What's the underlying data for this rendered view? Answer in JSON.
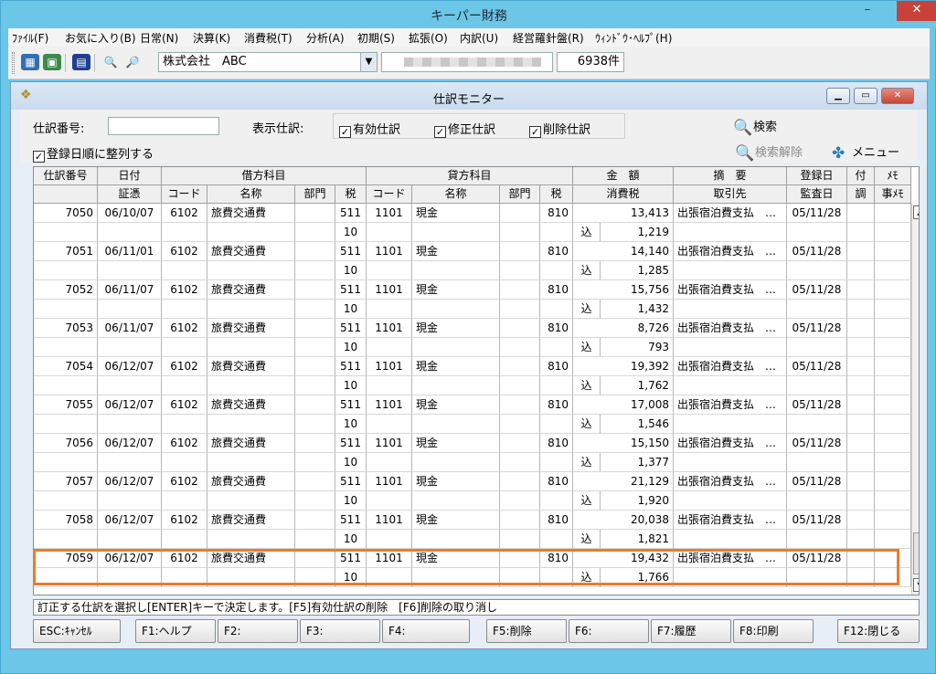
{
  "app": {
    "title": "キーパー財務",
    "window_buttons": {
      "minimize": "–",
      "maximize": "□",
      "close": "✕"
    }
  },
  "menu": [
    "ﾌｧｲﾙ(F)",
    "お気に入り(B)",
    "日常(N)",
    "決算(K)",
    "消費税(T)",
    "分析(A)",
    "初期(S)",
    "拡張(O)",
    "内訳(U)",
    "経営羅針盤(R)",
    "ｳｨﾝﾄﾞｳ･ﾍﾙﾌﾟ(H)"
  ],
  "toolbar": {
    "company": "株式会社　ABC",
    "count": "6938件"
  },
  "monitor": {
    "title": "仕訳モニター",
    "journal_no_label": "仕訳番号:",
    "journal_no_value": "",
    "display_label": "表示仕訳:",
    "checks": {
      "valid": "有効仕訳",
      "corrected": "修正仕訳",
      "deleted": "削除仕訳",
      "sort": "登録日順に整列する"
    },
    "search_label": "検索",
    "search_clear_label": "検索解除",
    "menu_label": "メニュー"
  },
  "grid": {
    "headers": {
      "journal_no": "仕訳番号",
      "date": "日付",
      "voucher": "証憑",
      "debit": "借方科目",
      "credit": "貸方科目",
      "code": "コード",
      "name": "名称",
      "dept": "部門",
      "tax": "税",
      "amount": "金　額",
      "consumption_tax": "消費税",
      "summary": "摘　要",
      "partner": "取引先",
      "reg_date": "登録日",
      "audit_date": "監査日",
      "attach": "付",
      "adjust": "調",
      "memo": "ﾒﾓ",
      "memo2": "事ﾒﾓ"
    },
    "rows": [
      {
        "no": "7050",
        "date": "06/10/07",
        "dcode": "6102",
        "dname": "旅費交通費",
        "dtax": "511",
        "dtax2": "10",
        "ccode": "1101",
        "cname": "現金",
        "ctax": "810",
        "amount": "13,413",
        "incl": "込",
        "tax": "1,219",
        "summary": "出張宿泊費支払　…",
        "reg": "05/11/28"
      },
      {
        "no": "7051",
        "date": "06/11/01",
        "dcode": "6102",
        "dname": "旅費交通費",
        "dtax": "511",
        "dtax2": "10",
        "ccode": "1101",
        "cname": "現金",
        "ctax": "810",
        "amount": "14,140",
        "incl": "込",
        "tax": "1,285",
        "summary": "出張宿泊費支払　…",
        "reg": "05/11/28"
      },
      {
        "no": "7052",
        "date": "06/11/07",
        "dcode": "6102",
        "dname": "旅費交通費",
        "dtax": "511",
        "dtax2": "10",
        "ccode": "1101",
        "cname": "現金",
        "ctax": "810",
        "amount": "15,756",
        "incl": "込",
        "tax": "1,432",
        "summary": "出張宿泊費支払　…",
        "reg": "05/11/28"
      },
      {
        "no": "7053",
        "date": "06/11/07",
        "dcode": "6102",
        "dname": "旅費交通費",
        "dtax": "511",
        "dtax2": "10",
        "ccode": "1101",
        "cname": "現金",
        "ctax": "810",
        "amount": "8,726",
        "incl": "込",
        "tax": "793",
        "summary": "出張宿泊費支払　…",
        "reg": "05/11/28"
      },
      {
        "no": "7054",
        "date": "06/12/07",
        "dcode": "6102",
        "dname": "旅費交通費",
        "dtax": "511",
        "dtax2": "10",
        "ccode": "1101",
        "cname": "現金",
        "ctax": "810",
        "amount": "19,392",
        "incl": "込",
        "tax": "1,762",
        "summary": "出張宿泊費支払　…",
        "reg": "05/11/28"
      },
      {
        "no": "7055",
        "date": "06/12/07",
        "dcode": "6102",
        "dname": "旅費交通費",
        "dtax": "511",
        "dtax2": "10",
        "ccode": "1101",
        "cname": "現金",
        "ctax": "810",
        "amount": "17,008",
        "incl": "込",
        "tax": "1,546",
        "summary": "出張宿泊費支払　…",
        "reg": "05/11/28"
      },
      {
        "no": "7056",
        "date": "06/12/07",
        "dcode": "6102",
        "dname": "旅費交通費",
        "dtax": "511",
        "dtax2": "10",
        "ccode": "1101",
        "cname": "現金",
        "ctax": "810",
        "amount": "15,150",
        "incl": "込",
        "tax": "1,377",
        "summary": "出張宿泊費支払　…",
        "reg": "05/11/28"
      },
      {
        "no": "7057",
        "date": "06/12/07",
        "dcode": "6102",
        "dname": "旅費交通費",
        "dtax": "511",
        "dtax2": "10",
        "ccode": "1101",
        "cname": "現金",
        "ctax": "810",
        "amount": "21,129",
        "incl": "込",
        "tax": "1,920",
        "summary": "出張宿泊費支払　…",
        "reg": "05/11/28"
      },
      {
        "no": "7058",
        "date": "06/12/07",
        "dcode": "6102",
        "dname": "旅費交通費",
        "dtax": "511",
        "dtax2": "10",
        "ccode": "1101",
        "cname": "現金",
        "ctax": "810",
        "amount": "20,038",
        "incl": "込",
        "tax": "1,821",
        "summary": "出張宿泊費支払　…",
        "reg": "05/11/28"
      },
      {
        "no": "7059",
        "date": "06/12/07",
        "dcode": "6102",
        "dname": "旅費交通費",
        "dtax": "511",
        "dtax2": "10",
        "ccode": "1101",
        "cname": "現金",
        "ctax": "810",
        "amount": "19,432",
        "incl": "込",
        "tax": "1,766",
        "summary": "出張宿泊費支払　…",
        "reg": "05/11/28"
      }
    ]
  },
  "status": "訂正する仕訳を選択し[ENTER]キーで決定します。[F5]有効仕訳の削除　[F6]削除の取り消し",
  "fkeys": [
    "ESC:ｷｬﾝｾﾙ",
    "F1:ヘルプ",
    "F2:",
    "F3:",
    "F4:",
    "F5:削除",
    "F6:",
    "F7:履歴",
    "F8:印刷",
    "F12:閉じる"
  ]
}
